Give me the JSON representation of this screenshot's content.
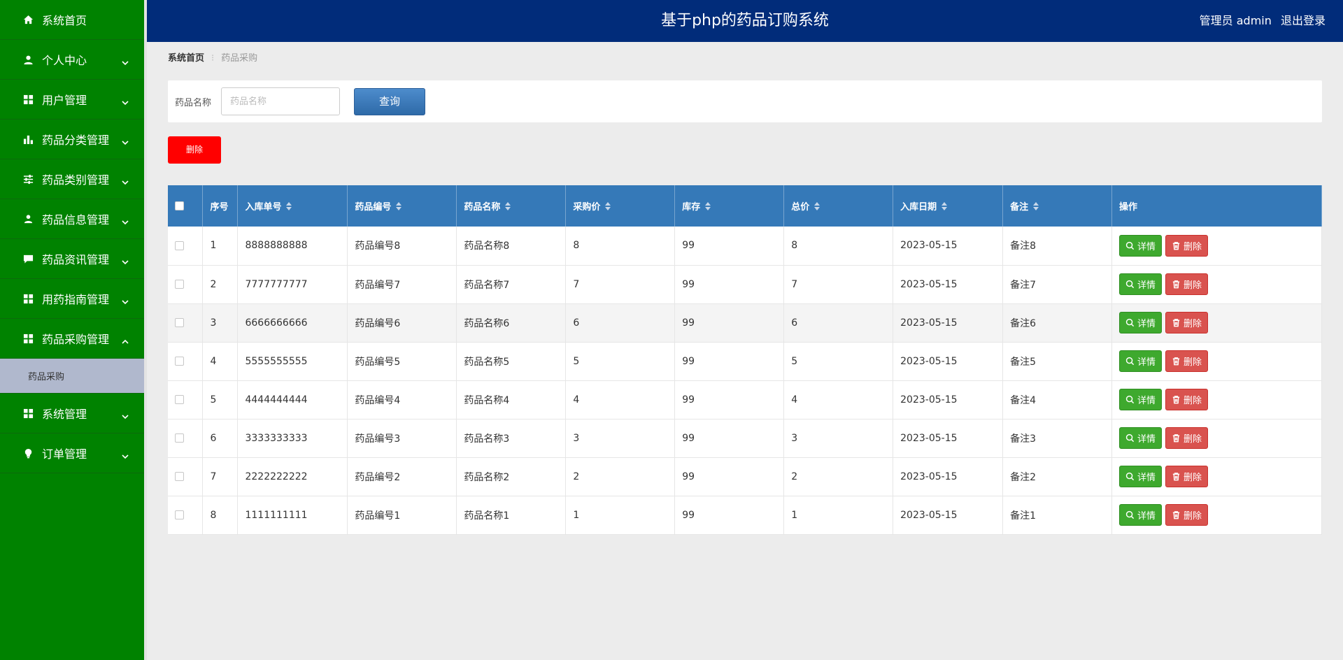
{
  "header": {
    "title": "基于php的药品订购系统",
    "user": "管理员 admin",
    "logout": "退出登录"
  },
  "sidebar": {
    "items": [
      {
        "label": "系统首页",
        "icon": "home-icon",
        "has_chevron": false
      },
      {
        "label": "个人中心",
        "icon": "person-icon",
        "has_chevron": true
      },
      {
        "label": "用户管理",
        "icon": "grid-icon",
        "has_chevron": true
      },
      {
        "label": "药品分类管理",
        "icon": "bar-chart-icon",
        "has_chevron": true
      },
      {
        "label": "药品类别管理",
        "icon": "sliders-icon",
        "has_chevron": true
      },
      {
        "label": "药品信息管理",
        "icon": "user-icon",
        "has_chevron": true
      },
      {
        "label": "药品资讯管理",
        "icon": "chat-icon",
        "has_chevron": true
      },
      {
        "label": "用药指南管理",
        "icon": "grid-icon",
        "has_chevron": true
      },
      {
        "label": "药品采购管理",
        "icon": "grid-icon",
        "has_chevron": true,
        "expanded": true
      },
      {
        "label": "系统管理",
        "icon": "grid-icon",
        "has_chevron": true
      },
      {
        "label": "订单管理",
        "icon": "bulb-icon",
        "has_chevron": true
      }
    ],
    "sub_item": "药品采购"
  },
  "breadcrumb": {
    "home": "系统首页",
    "current": "药品采购"
  },
  "search": {
    "label": "药品名称",
    "placeholder": "药品名称",
    "button": "查询"
  },
  "bulk_delete": "删除",
  "table": {
    "columns": [
      "序号",
      "入库单号",
      "药品编号",
      "药品名称",
      "采购价",
      "库存",
      "总价",
      "入库日期",
      "备注",
      "操作"
    ],
    "rows": [
      {
        "no": "1",
        "order": "8888888888",
        "code": "药品编号8",
        "name": "药品名称8",
        "price": "8",
        "stock": "99",
        "total": "8",
        "date": "2023-05-15",
        "note": "备注8"
      },
      {
        "no": "2",
        "order": "7777777777",
        "code": "药品编号7",
        "name": "药品名称7",
        "price": "7",
        "stock": "99",
        "total": "7",
        "date": "2023-05-15",
        "note": "备注7"
      },
      {
        "no": "3",
        "order": "6666666666",
        "code": "药品编号6",
        "name": "药品名称6",
        "price": "6",
        "stock": "99",
        "total": "6",
        "date": "2023-05-15",
        "note": "备注6"
      },
      {
        "no": "4",
        "order": "5555555555",
        "code": "药品编号5",
        "name": "药品名称5",
        "price": "5",
        "stock": "99",
        "total": "5",
        "date": "2023-05-15",
        "note": "备注5"
      },
      {
        "no": "5",
        "order": "4444444444",
        "code": "药品编号4",
        "name": "药品名称4",
        "price": "4",
        "stock": "99",
        "total": "4",
        "date": "2023-05-15",
        "note": "备注4"
      },
      {
        "no": "6",
        "order": "3333333333",
        "code": "药品编号3",
        "name": "药品名称3",
        "price": "3",
        "stock": "99",
        "total": "3",
        "date": "2023-05-15",
        "note": "备注3"
      },
      {
        "no": "7",
        "order": "2222222222",
        "code": "药品编号2",
        "name": "药品名称2",
        "price": "2",
        "stock": "99",
        "total": "2",
        "date": "2023-05-15",
        "note": "备注2"
      },
      {
        "no": "8",
        "order": "1111111111",
        "code": "药品编号1",
        "name": "药品名称1",
        "price": "1",
        "stock": "99",
        "total": "1",
        "date": "2023-05-15",
        "note": "备注1"
      }
    ],
    "detail_label": "详情",
    "delete_label": "删除"
  },
  "colors": {
    "sidebar": "#008200",
    "header": "#012c7a",
    "table_header": "#3579b8",
    "detail_button": "#3ea92e",
    "delete_button": "#d9534f",
    "bulk_delete": "#ff0000"
  }
}
